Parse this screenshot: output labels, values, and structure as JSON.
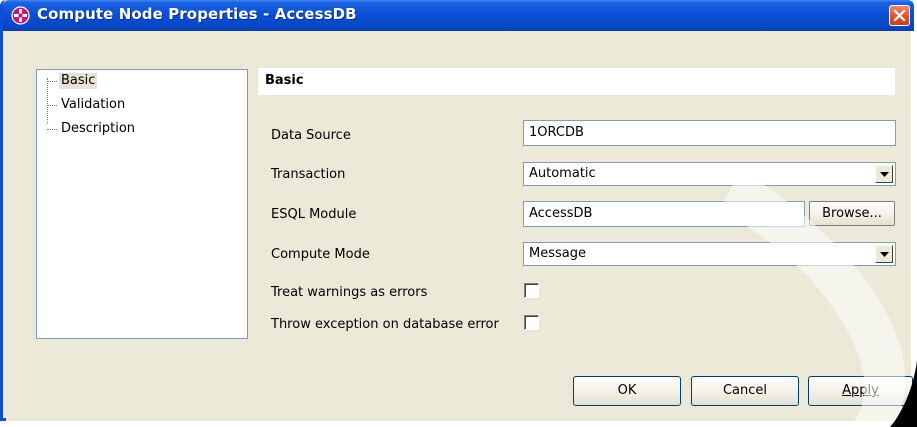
{
  "window": {
    "title": "Compute Node Properties - AccessDB"
  },
  "tree": {
    "items": [
      {
        "label": "Basic",
        "selected": true
      },
      {
        "label": "Validation",
        "selected": false
      },
      {
        "label": "Description",
        "selected": false
      }
    ]
  },
  "section": {
    "title": "Basic"
  },
  "fields": {
    "data_source": {
      "label": "Data Source",
      "value": "1ORCDB"
    },
    "transaction": {
      "label": "Transaction",
      "value": "Automatic"
    },
    "esql_module": {
      "label": "ESQL Module",
      "value": "AccessDB"
    },
    "compute_mode": {
      "label": "Compute Mode",
      "value": "Message"
    },
    "treat_warnings": {
      "label": "Treat warnings as errors",
      "checked": false
    },
    "throw_exception": {
      "label": "Throw exception on database error",
      "checked": false
    }
  },
  "buttons": {
    "browse": "Browse...",
    "ok": "OK",
    "cancel": "Cancel",
    "apply": "Apply"
  },
  "colors": {
    "titlebar": "#0a52d8",
    "close": "#e15a37",
    "background": "#ece9d8"
  }
}
